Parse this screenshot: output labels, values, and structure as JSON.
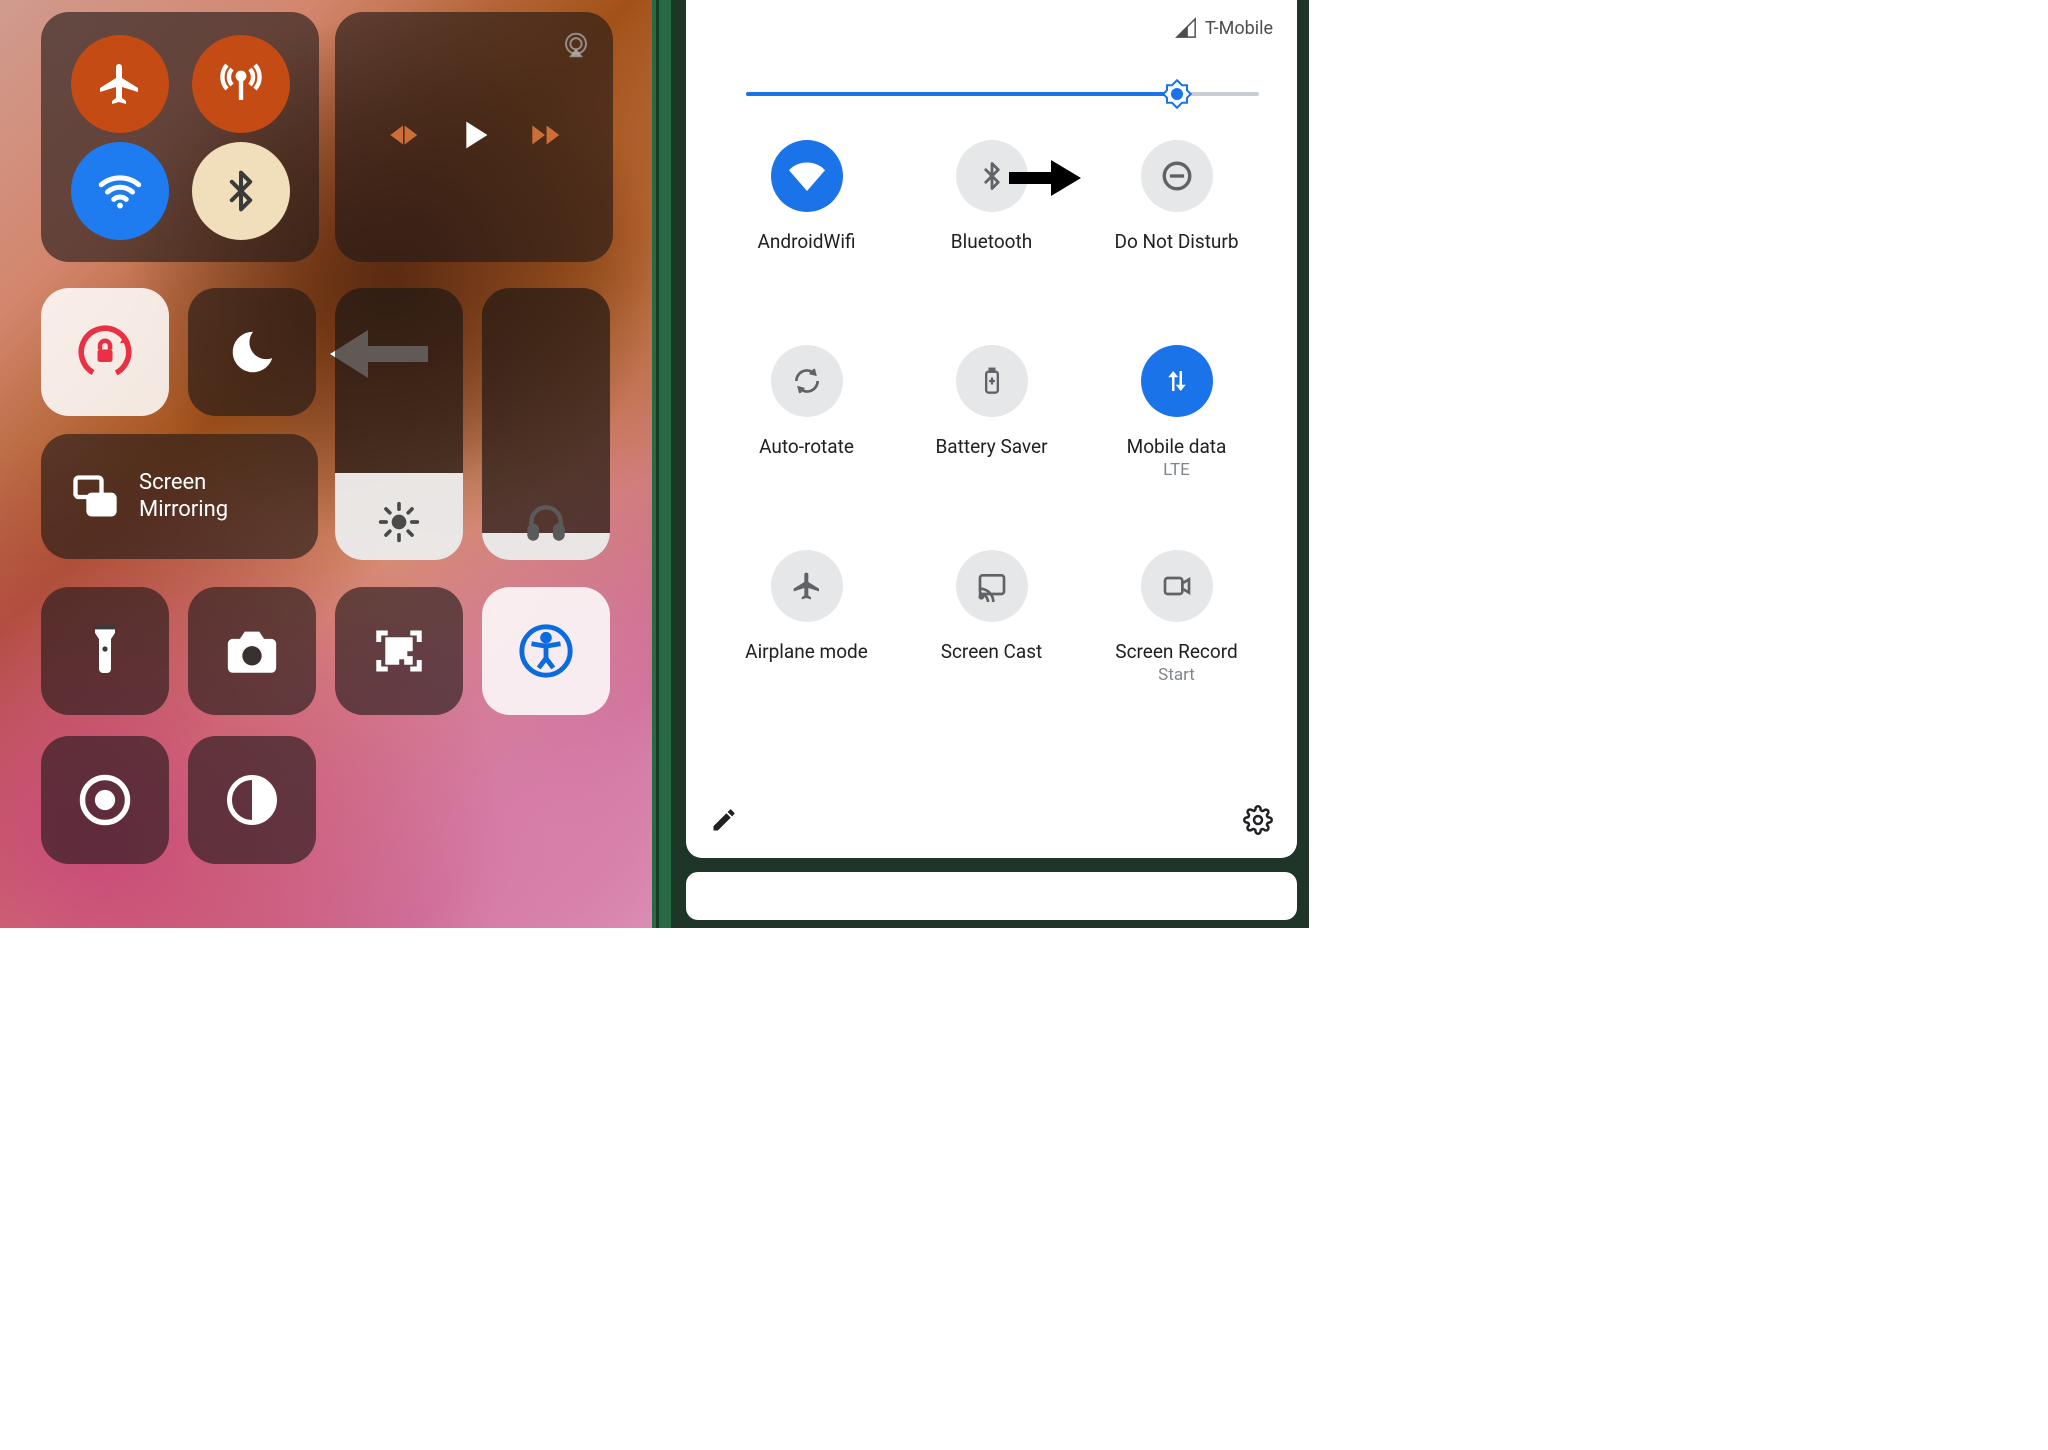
{
  "ios": {
    "connectivity": {
      "airplane_active": true,
      "cellular_active": true,
      "wifi_active": true,
      "bluetooth_active": true
    },
    "screen_mirroring_label": "Screen\nMirroring",
    "brightness_percent": 32,
    "volume_percent": 10
  },
  "android": {
    "carrier": "T-Mobile",
    "brightness_percent": 84,
    "tiles": [
      {
        "label": "AndroidWifi",
        "sublabel": "",
        "icon": "wifi",
        "on": true
      },
      {
        "label": "Bluetooth",
        "sublabel": "",
        "icon": "bluetooth",
        "on": false
      },
      {
        "label": "Do Not Disturb",
        "sublabel": "",
        "icon": "dnd",
        "on": false,
        "pointer": true
      },
      {
        "label": "Auto-rotate",
        "sublabel": "",
        "icon": "autorotate",
        "on": false
      },
      {
        "label": "Battery Saver",
        "sublabel": "",
        "icon": "battery",
        "on": false
      },
      {
        "label": "Mobile data",
        "sublabel": "LTE",
        "icon": "mobiledata",
        "on": true
      },
      {
        "label": "Airplane mode",
        "sublabel": "",
        "icon": "airplane",
        "on": false
      },
      {
        "label": "Screen Cast",
        "sublabel": "",
        "icon": "cast",
        "on": false
      },
      {
        "label": "Screen Record",
        "sublabel": "Start",
        "icon": "record",
        "on": false
      }
    ]
  }
}
